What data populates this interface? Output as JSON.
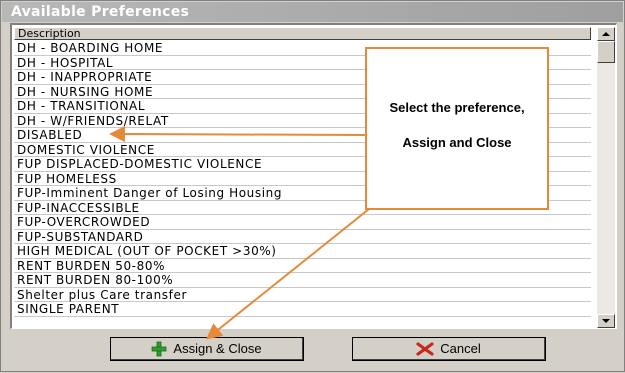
{
  "window": {
    "title": "Available Preferences"
  },
  "list": {
    "header": "Description",
    "items": [
      "DH - BOARDING HOME",
      "DH - HOSPITAL",
      "DH - INAPPROPRIATE",
      "DH - NURSING HOME",
      "DH - TRANSITIONAL",
      "DH - W/FRIENDS/RELAT",
      "DISABLED",
      "DOMESTIC VIOLENCE",
      "FUP DISPLACED-DOMESTIC VIOLENCE",
      "FUP HOMELESS",
      "FUP-Imminent Danger of Losing Housing",
      "FUP-INACCESSIBLE",
      "FUP-OVERCROWDED",
      "FUP-SUBSTANDARD",
      "HIGH MEDICAL (OUT OF POCKET >30%)",
      "RENT BURDEN 50-80%",
      "RENT BURDEN 80-100%",
      "Shelter plus Care transfer",
      "SINGLE PARENT"
    ]
  },
  "buttons": {
    "assign_label": "Assign & Close",
    "cancel_label": "Cancel",
    "assign_icon": "plus-icon",
    "cancel_icon": "x-icon"
  },
  "callout": {
    "line1": "Select the preference,",
    "line2": "Assign and Close"
  },
  "colors": {
    "accent": "#e68a3a",
    "plus_icon": "#2e9e2e",
    "cancel_icon": "#c8281e"
  }
}
